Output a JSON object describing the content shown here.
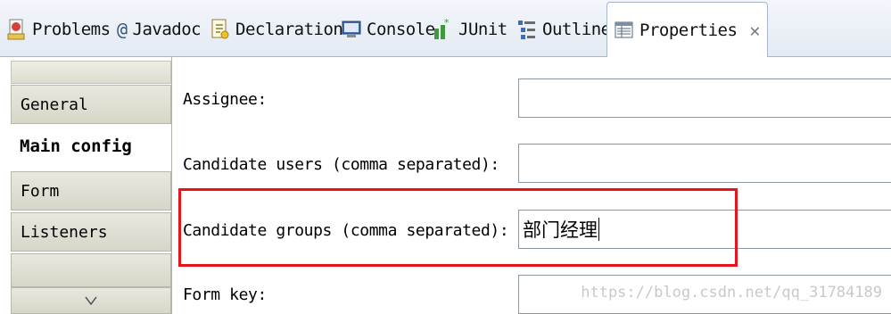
{
  "tabs": [
    {
      "label": "Problems",
      "icon": "problems-icon"
    },
    {
      "label": "Javadoc",
      "icon": "javadoc-icon"
    },
    {
      "label": "Declaration",
      "icon": "declaration-icon"
    },
    {
      "label": "Console",
      "icon": "console-icon"
    },
    {
      "label": "JUnit",
      "icon": "junit-icon"
    },
    {
      "label": "Outline",
      "icon": "outline-icon"
    },
    {
      "label": "Properties",
      "icon": "properties-icon",
      "active": true
    }
  ],
  "nav": {
    "items": [
      "General",
      "Main config",
      "Form",
      "Listeners"
    ],
    "selected": "Main config"
  },
  "form": {
    "assignee_label": "Assignee:",
    "assignee_value": "",
    "candidate_users_label": "Candidate users (comma separated):",
    "candidate_users_value": "",
    "candidate_groups_label": "Candidate groups (comma separated):",
    "candidate_groups_value": "部门经理",
    "form_key_label": "Form key:",
    "form_key_value": ""
  },
  "watermark": "https://blog.csdn.net/qq_31784189",
  "colors": {
    "highlight": "#e8141b"
  }
}
